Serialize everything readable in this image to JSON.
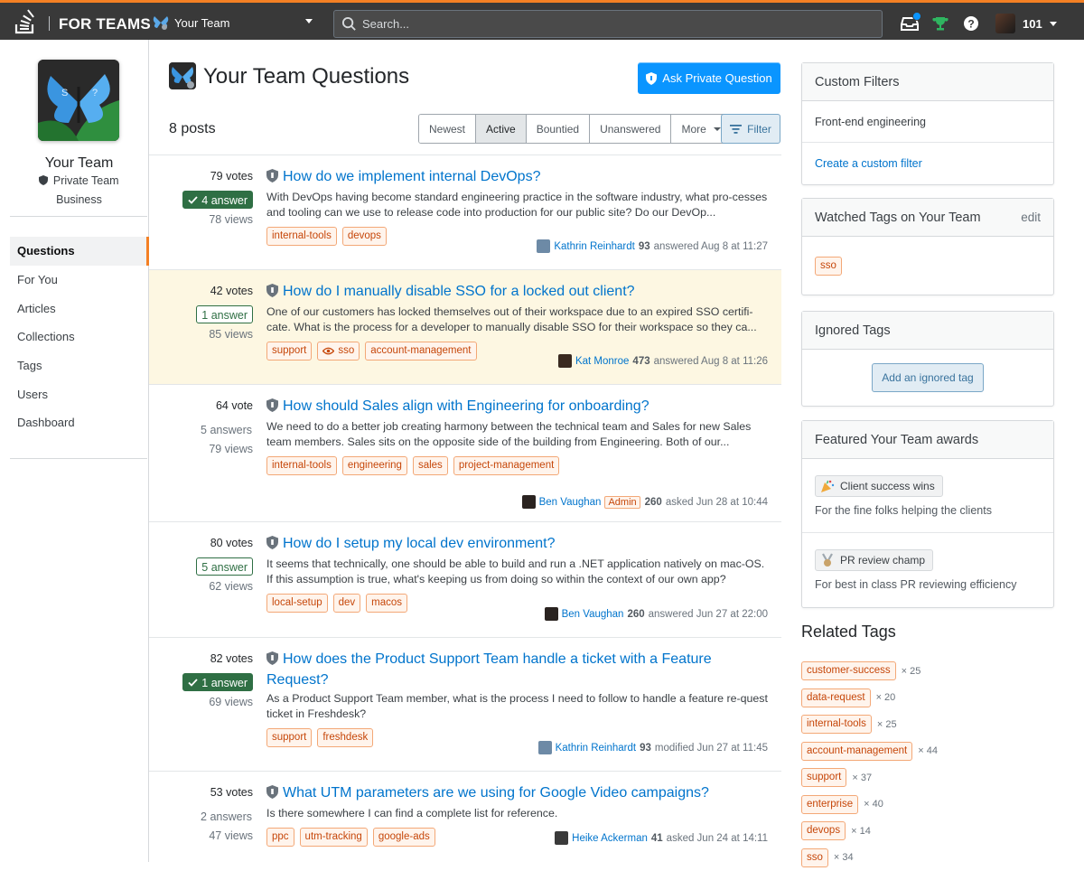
{
  "topbar": {
    "brand": "FOR TEAMS",
    "team_name": "Your Team",
    "search_placeholder": "Search...",
    "reputation": "101"
  },
  "sidebar": {
    "team_name": "Your Team",
    "privacy": "Private Team",
    "plan": "Business",
    "nav": [
      {
        "label": "Questions",
        "active": true
      },
      {
        "label": "For You"
      },
      {
        "label": "Articles"
      },
      {
        "label": "Collections"
      },
      {
        "label": "Tags"
      },
      {
        "label": "Users"
      },
      {
        "label": "Dashboard"
      }
    ]
  },
  "main": {
    "title": "Your Team Questions",
    "ask_button": "Ask Private Question",
    "post_count": "8 posts",
    "filters": [
      "Newest",
      "Active",
      "Bountied",
      "Unanswered",
      "More"
    ],
    "selected_filter": "Active",
    "filter_button": "Filter"
  },
  "questions": [
    {
      "votes": "79 votes",
      "answers": "4 answer",
      "answer_state": "accepted",
      "views": "78 views",
      "title": "How do we implement internal DevOps?",
      "excerpt": "With DevOps having become standard engineering practice in the software industry, what pro-cesses and tooling can we use to release code into production for our public site? Do our DevOp...",
      "tags": [
        "internal-tools",
        "devops"
      ],
      "user": "Kathrin Reinhardt",
      "rep": "93",
      "action": "answered Aug 8 at 11:27",
      "highlight": false
    },
    {
      "votes": "42 votes",
      "answers": "1 answer",
      "answer_state": "answered",
      "views": "85 views",
      "title": "How do I manually disable SSO for a locked out client?",
      "excerpt": "One of our customers has locked themselves out of their workspace due to an expired SSO certifi-cate. What is the process for a developer to manually disable SSO for their workspace so they ca...",
      "tags": [
        "support",
        "sso",
        "account-management"
      ],
      "user": "Kat Monroe",
      "rep": "473",
      "action": "answered Aug 8 at 11:26",
      "highlight": true
    },
    {
      "votes": "64 vote",
      "answers": "5 answers",
      "answer_state": "none",
      "views": "79 views",
      "title": "How should Sales align with Engineering for onboarding?",
      "excerpt": "We need to do a better job creating harmony between the technical team and Sales for new Sales team members. Sales sits on the opposite side of the building from Engineering. Both of our...",
      "tags": [
        "internal-tools",
        "engineering",
        "sales",
        "project-management"
      ],
      "user": "Ben Vaughan",
      "badge": "Admin",
      "rep": "260",
      "action": "asked Jun 28 at 10:44",
      "highlight": false
    },
    {
      "votes": "80 votes",
      "answers": "5 answer",
      "answer_state": "answered",
      "views": "62 views",
      "title": "How do I setup my local dev environment?",
      "excerpt": "It seems that technically, one should be able to build and run a .NET application natively on mac-OS. If this assumption is true, what's keeping us from doing so within the context of our own app?",
      "tags": [
        "local-setup",
        "dev",
        "macos"
      ],
      "user": "Ben Vaughan",
      "rep": "260",
      "action": "answered Jun 27 at 22:00",
      "highlight": false
    },
    {
      "votes": "82 votes",
      "answers": "1 answer",
      "answer_state": "accepted",
      "views": "69 views",
      "title": "How does the Product Support Team handle a ticket with a Feature Request?",
      "excerpt": "As a Product Support Team member, what is the process I need to follow to handle a feature re-quest ticket in Freshdesk?",
      "tags": [
        "support",
        "freshdesk"
      ],
      "user": "Kathrin Reinhardt",
      "rep": "93",
      "action": "modified Jun 27 at 11:45",
      "highlight": false
    },
    {
      "votes": "53 votes",
      "answers": "2 answers",
      "answer_state": "none",
      "views": "47 views",
      "title": "What UTM parameters are we using for Google Video campaigns?",
      "excerpt": "Is there somewhere I can find a complete list for reference.",
      "tags": [
        "ppc",
        "utm-tracking",
        "google-ads"
      ],
      "user": "Heike Ackerman",
      "rep": "41",
      "action": "asked Jun 24 at 14:11",
      "highlight": false
    }
  ],
  "right": {
    "custom_filters": {
      "title": "Custom Filters",
      "item": "Front-end engineering",
      "create": "Create a custom filter"
    },
    "watched": {
      "title": "Watched Tags on Your Team",
      "edit": "edit",
      "tags": [
        "sso"
      ]
    },
    "ignored": {
      "title": "Ignored Tags",
      "button": "Add an ignored tag"
    },
    "awards": {
      "title": "Featured Your Team awards",
      "items": [
        {
          "name": "Client success wins",
          "desc": "For the fine folks helping the clients",
          "icon": "party-popper-icon"
        },
        {
          "name": "PR review champ",
          "desc": "For best in class PR reviewing efficiency",
          "icon": "medal-icon"
        }
      ]
    },
    "related_title": "Related Tags",
    "related": [
      {
        "tag": "customer-success",
        "count": "× 25"
      },
      {
        "tag": "data-request",
        "count": "× 20"
      },
      {
        "tag": "internal-tools",
        "count": "× 25"
      },
      {
        "tag": "account-management",
        "count": "× 44"
      },
      {
        "tag": "support",
        "count": "× 37"
      },
      {
        "tag": "enterprise",
        "count": "× 40"
      },
      {
        "tag": "devops",
        "count": "× 14"
      },
      {
        "tag": "sso",
        "count": "× 34"
      }
    ]
  },
  "colors": {
    "accent": "#f48024",
    "link": "#0074cc",
    "primary": "#0a95ff",
    "accepted": "#2f6f44",
    "highlight": "#fdf7e2"
  }
}
